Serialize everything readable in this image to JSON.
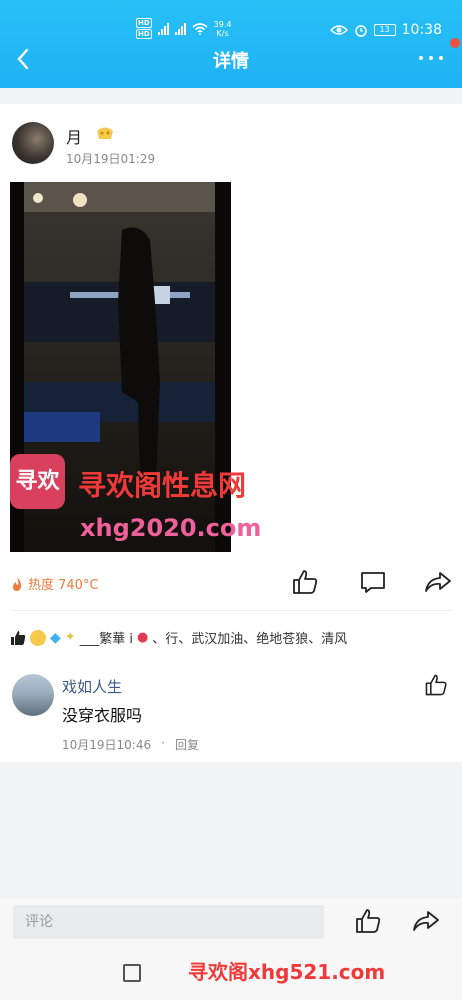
{
  "status_bar": {
    "network_speed": "39.4",
    "speed_unit": "K/s",
    "battery": "13",
    "time": "10:38"
  },
  "header": {
    "title": "详情"
  },
  "post": {
    "author": "月",
    "timestamp": "10月19日01:29",
    "heat": "热度 740°C",
    "likers_text": "___繁華 i",
    "likers_tail": "、行、武汉加油、绝地苍狼、清风"
  },
  "watermark": {
    "logo_text": "寻欢",
    "cn_text": "寻欢阁性息网",
    "url": "xhg2020.com",
    "bottom_text": "寻欢阁xhg521.com"
  },
  "comment": {
    "author": "戏如人生",
    "text": "没穿衣服吗",
    "timestamp": "10月19日10:46",
    "reply_label": "回复"
  },
  "bottom_bar": {
    "input_placeholder": "评论"
  },
  "colors": {
    "header": "#1fb2f3",
    "heat": "#f07a3a",
    "commenter_name": "#3a5a88"
  }
}
